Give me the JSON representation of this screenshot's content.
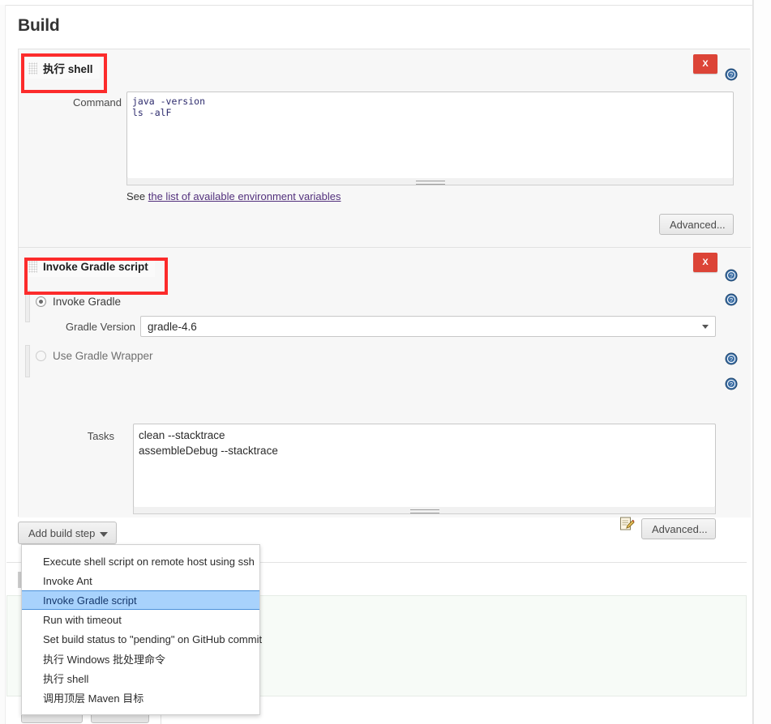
{
  "page": {
    "title": "Build"
  },
  "steps": [
    {
      "name": "shell-step",
      "title": "执行 shell",
      "grip_icon": "drag-grip-icon",
      "delete_label": "X",
      "help_icon": "help-icon",
      "command": {
        "label": "Command",
        "value": "java -version\nls -alF"
      },
      "hint": {
        "prefix": "See ",
        "link_text": "the list of available environment variables"
      },
      "advanced_label": "Advanced..."
    },
    {
      "name": "gradle-step",
      "title": "Invoke Gradle script",
      "grip_icon": "drag-grip-icon",
      "delete_label": "X",
      "radio_invoke_gradle": "Invoke Gradle",
      "radio_use_wrapper": "Use Gradle Wrapper",
      "gradle_version": {
        "label": "Gradle Version",
        "value": "gradle-4.6"
      },
      "tasks": {
        "label": "Tasks",
        "value": "clean --stacktrace\nassembleDebug --stacktrace"
      },
      "edit_icon": "notepad-edit-icon",
      "advanced_label": "Advanced..."
    }
  ],
  "add_build_step": {
    "label": "Add build step",
    "caret_icon": "chevron-down-icon",
    "menu_items": [
      {
        "label": "Execute shell script on remote host using ssh",
        "selected": false
      },
      {
        "label": "Invoke Ant",
        "selected": false
      },
      {
        "label": "Invoke Gradle script",
        "selected": true
      },
      {
        "label": "Run with timeout",
        "selected": false
      },
      {
        "label": "Set build status to \"pending\" on GitHub commit",
        "selected": false
      },
      {
        "label": "执行 Windows 批处理命令",
        "selected": false
      },
      {
        "label": "执行 shell",
        "selected": false
      },
      {
        "label": "调用顶层 Maven 目标",
        "selected": false
      }
    ]
  },
  "colors": {
    "annotation_red": "#fc2b2b",
    "delete_red": "#dc4437",
    "menu_select_blue": "#a8d2fc",
    "help_blue": "#2c5d92",
    "link_purple": "#52307c"
  }
}
